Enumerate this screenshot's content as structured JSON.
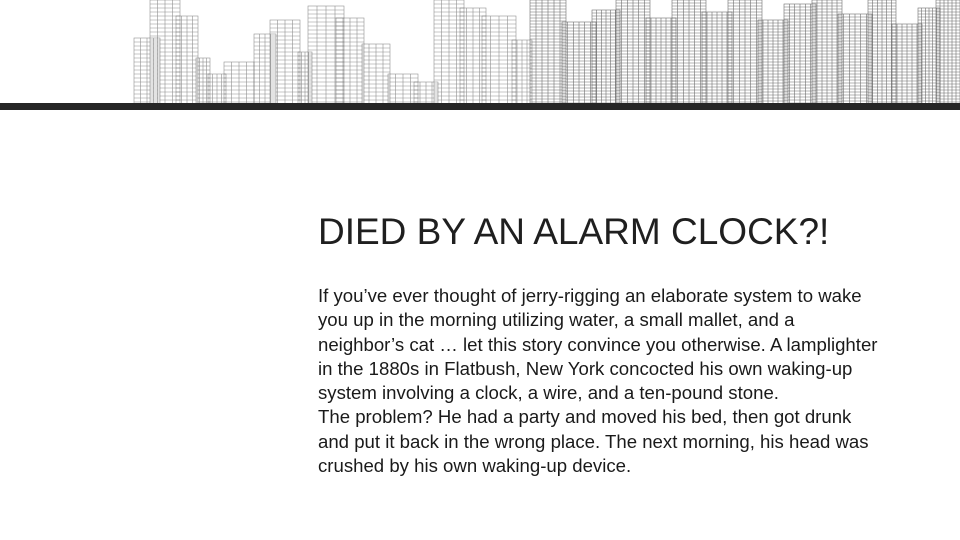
{
  "slide": {
    "title": "DIED BY AN ALARM CLOCK?!",
    "paragraphs": [
      "If you’ve ever thought of jerry-rigging an elaborate system to wake you up in the morning utilizing water, a small mallet, and a neighbor’s cat … let this story convince you otherwise. A lamplighter in the 1880s in Flatbush, New York concocted his own waking-up system involving a clock, a wire, and a ten-pound stone.",
      "The problem? He had a party and moved his bed, then got drunk and put it back in the wrong place. The next morning, his head was crushed by his own waking-up device."
    ]
  },
  "theme": {
    "text_color": "#1f1f1f",
    "rule_color": "#262626",
    "skyline_color": "#555555"
  }
}
